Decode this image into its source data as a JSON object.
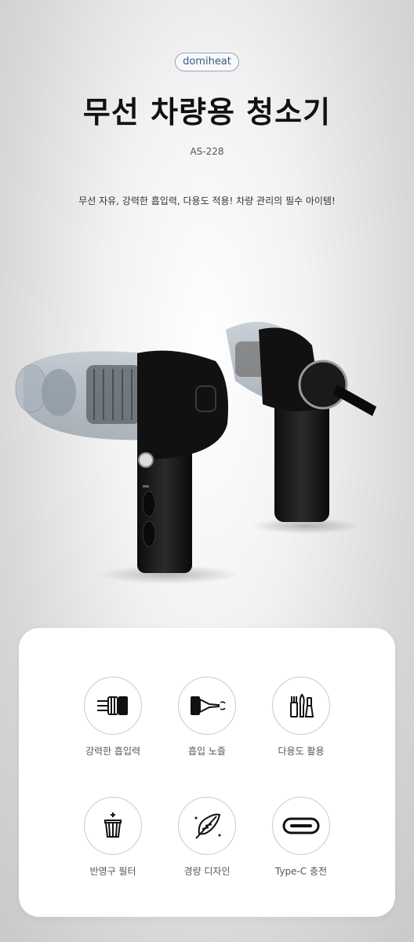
{
  "brand": "domiheat",
  "title": "무선 차량용 청소기",
  "model": "AS-228",
  "tagline": "무선 자유, 강력한 흡입력, 다용도 적용! 차량 관리의 필수 아이템!",
  "features": [
    {
      "label": "강력한 흡입력",
      "icon": "motor-icon"
    },
    {
      "label": "흡입 노즐",
      "icon": "nozzle-icon"
    },
    {
      "label": "다용도 활용",
      "icon": "tools-icon"
    },
    {
      "label": "반영구 필터",
      "icon": "filter-icon"
    },
    {
      "label": "경량 디자인",
      "icon": "feather-icon"
    },
    {
      "label": "Type-C 충전",
      "icon": "usb-c-icon"
    }
  ]
}
